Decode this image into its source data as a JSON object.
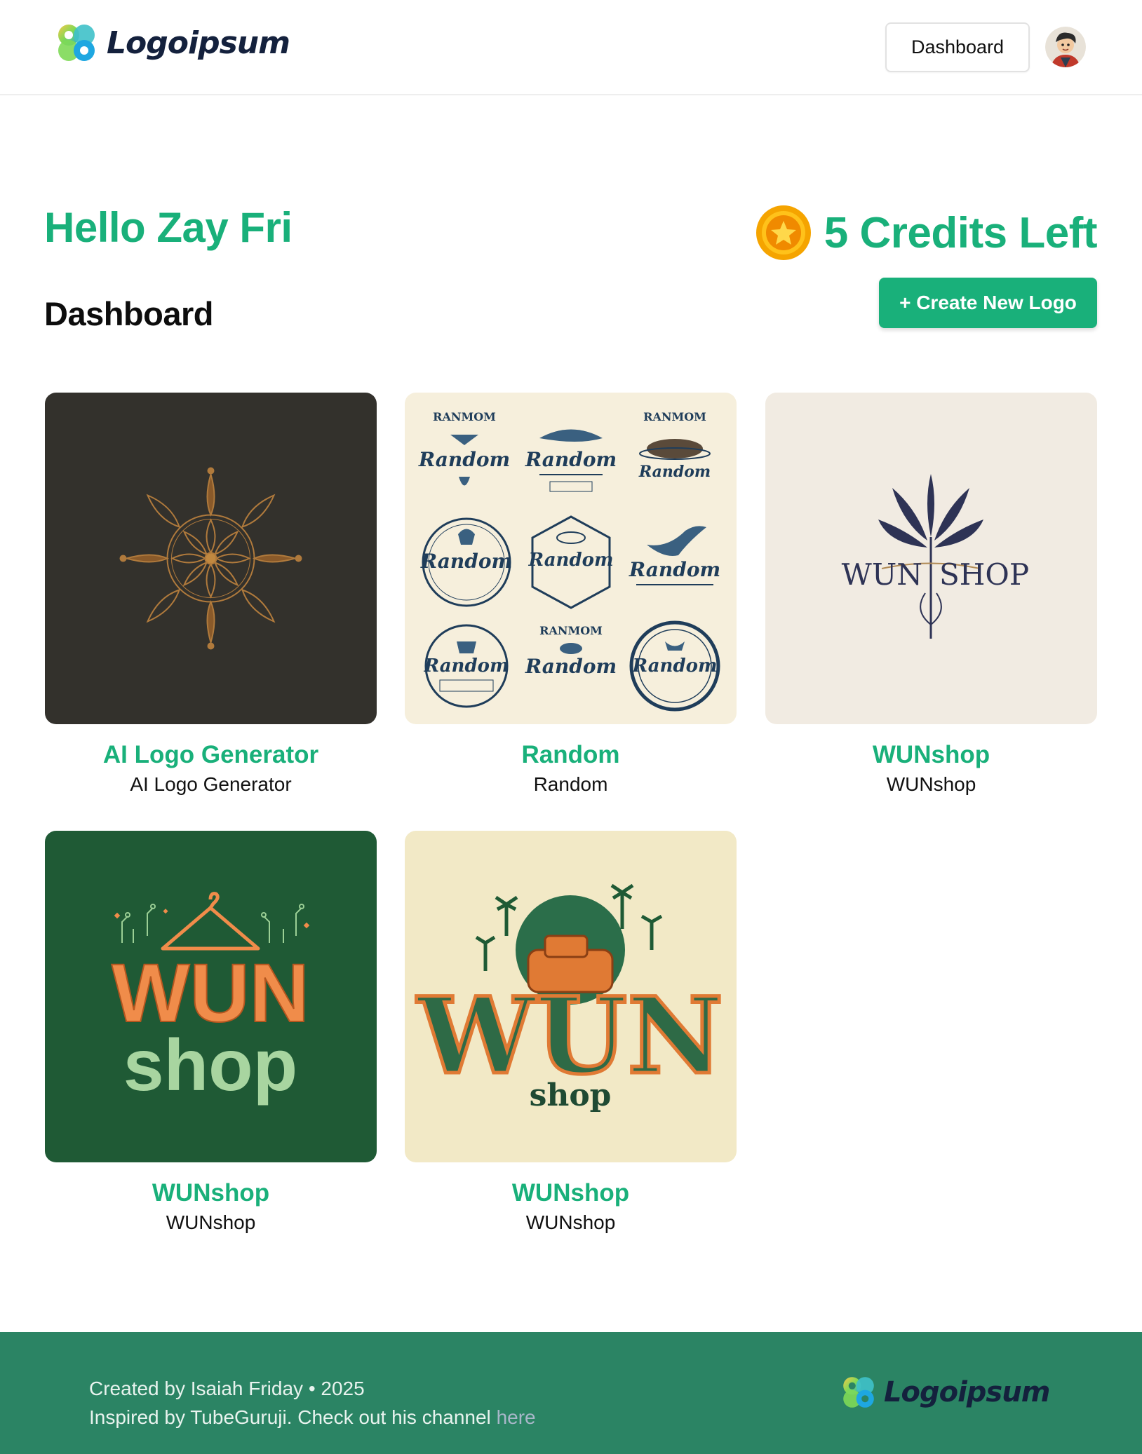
{
  "header": {
    "brand_name": "Logoipsum",
    "dashboard_button": "Dashboard",
    "avatar_icon": "user-avatar"
  },
  "greeting": {
    "text": "Hello Zay Fri",
    "credits_text": "5 Credits Left",
    "credits_icon": "star-coin-icon"
  },
  "main": {
    "title": "Dashboard",
    "create_button": "+ Create New Logo",
    "logos": [
      {
        "title": "AI Logo Generator",
        "description": "AI Logo Generator"
      },
      {
        "title": "Random",
        "description": "Random"
      },
      {
        "title": "WUNshop",
        "description": "WUNshop"
      },
      {
        "title": "WUNshop",
        "description": "WUNshop"
      },
      {
        "title": "WUNshop",
        "description": "WUNshop"
      }
    ],
    "thumb_text": {
      "random_word": "Random",
      "ranmom": "RANMOM",
      "wun_shop_left": "WUN",
      "wun_shop_right": "SHOP",
      "wun": "WUN",
      "shop": "shop"
    }
  },
  "footer": {
    "line1": "Created by Isaiah Friday • 2025",
    "line2_prefix": "Inspired by TubeGuruji. Check out his channel ",
    "line2_link": "here",
    "brand_name": "Logoipsum"
  },
  "colors": {
    "accent": "#19b07a",
    "footer_bg": "#2b8464",
    "brand_text": "#14213d"
  }
}
